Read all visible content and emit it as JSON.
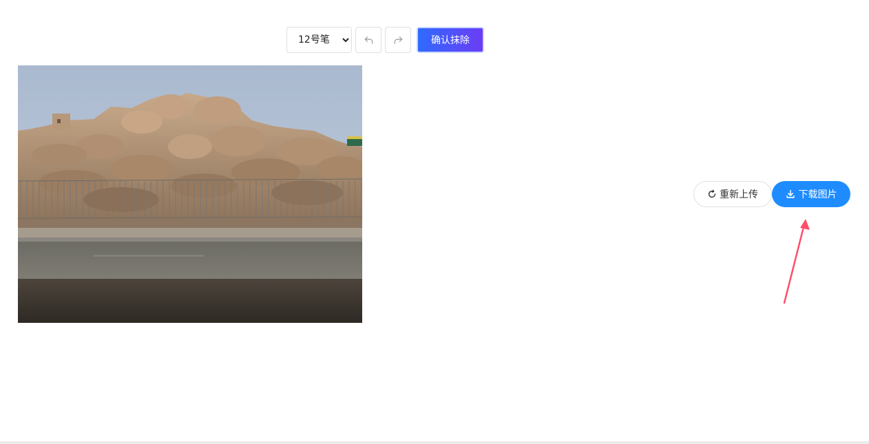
{
  "toolbar": {
    "brush_size": {
      "selected": "12号笔",
      "options": [
        "12号笔"
      ]
    },
    "undo_icon": "undo-icon",
    "redo_icon": "redo-icon",
    "confirm_label": "确认抹除",
    "confirm_gradient": [
      "#2f6bff",
      "#6b3cf5"
    ]
  },
  "preview": {
    "content": "photo of rocky hill with fence and road"
  },
  "actions": {
    "reupload_label": "重新上传",
    "reupload_icon": "refresh-icon",
    "download_label": "下载图片",
    "download_icon": "download-icon",
    "download_color": "#1e8cff"
  },
  "annotation": {
    "arrow_color": "#ff4d6a"
  }
}
